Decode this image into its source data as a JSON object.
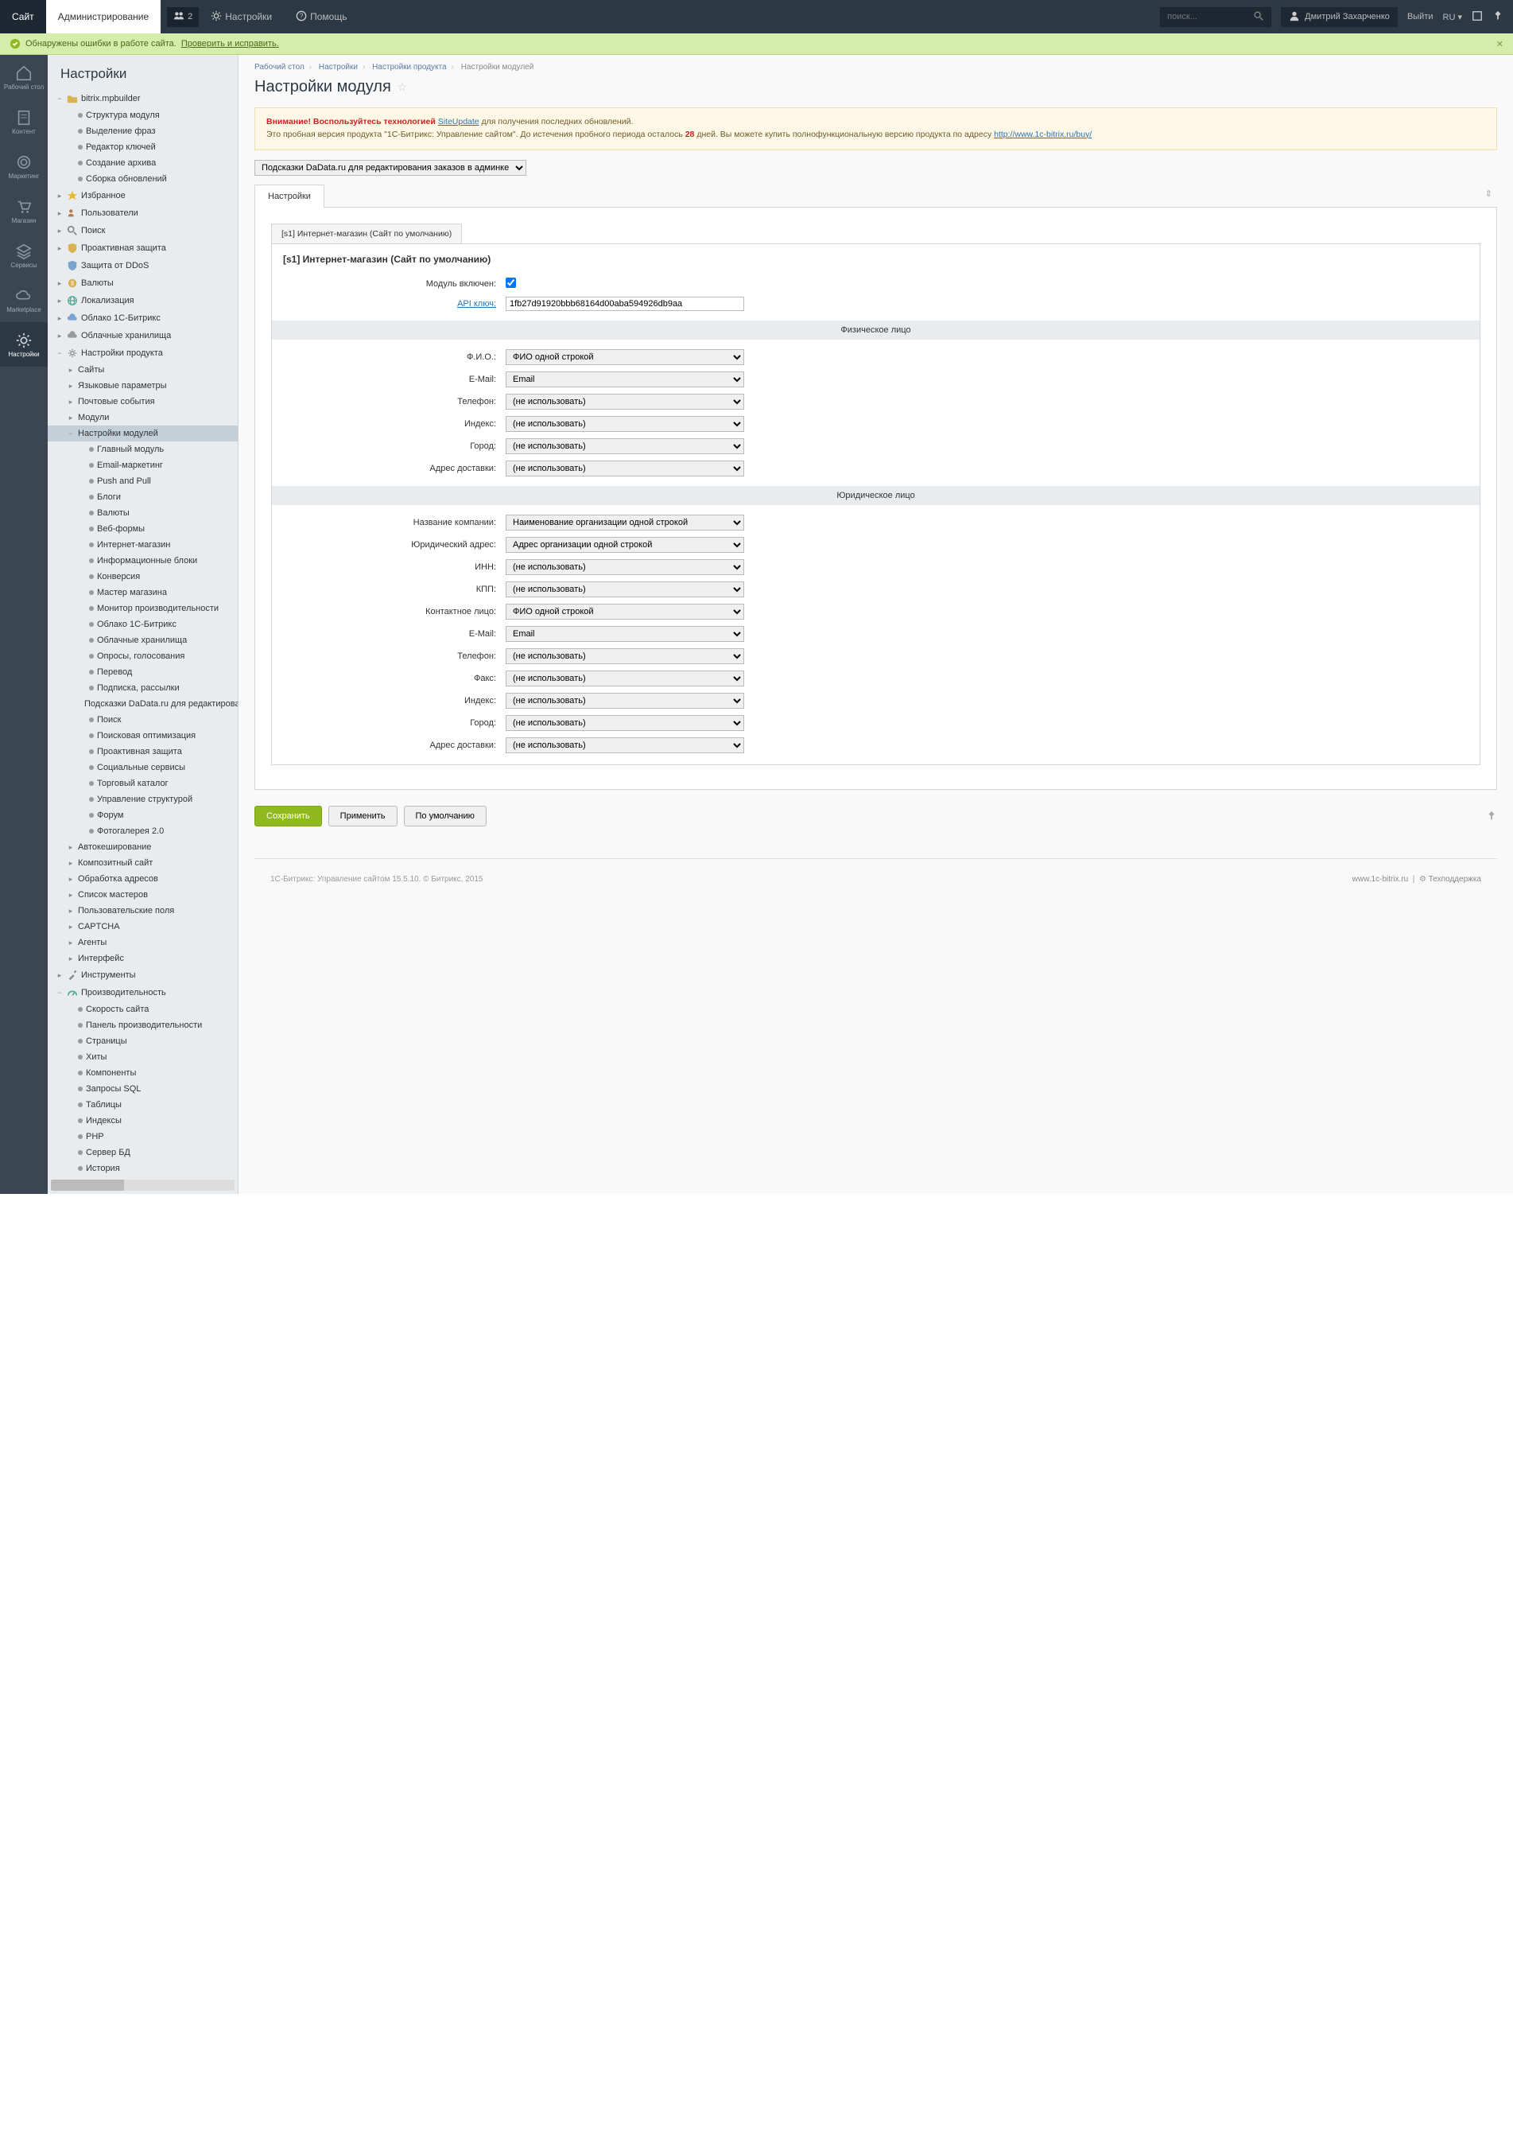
{
  "topbar": {
    "tab_site": "Сайт",
    "tab_admin": "Администрирование",
    "badge_count": "2",
    "link_settings": "Настройки",
    "link_help": "Помощь",
    "search_placeholder": "поиск...",
    "user_name": "Дмитрий Захарченко",
    "logout": "Выйти",
    "lang": "RU"
  },
  "alert": {
    "text": "Обнаружены ошибки в работе сайта.",
    "link": "Проверить и исправить."
  },
  "iconbar": {
    "items": [
      "Рабочий стол",
      "Контент",
      "Маркетинг",
      "Магазин",
      "Сервисы",
      "Marketplace",
      "Настройки"
    ]
  },
  "sidebar": {
    "title": "Настройки",
    "tree": [
      {
        "lvl": 0,
        "arrow": "−",
        "icon": "folder",
        "label": "bitrix.mpbuilder"
      },
      {
        "lvl": 1,
        "dot": true,
        "label": "Структура модуля"
      },
      {
        "lvl": 1,
        "dot": true,
        "label": "Выделение фраз"
      },
      {
        "lvl": 1,
        "dot": true,
        "label": "Редактор ключей"
      },
      {
        "lvl": 1,
        "dot": true,
        "label": "Создание архива"
      },
      {
        "lvl": 1,
        "dot": true,
        "label": "Сборка обновлений"
      },
      {
        "lvl": 0,
        "arrow": "▸",
        "icon": "star",
        "label": "Избранное"
      },
      {
        "lvl": 0,
        "arrow": "▸",
        "icon": "users",
        "label": "Пользователи"
      },
      {
        "lvl": 0,
        "arrow": "▸",
        "icon": "search",
        "label": "Поиск"
      },
      {
        "lvl": 0,
        "arrow": "▸",
        "icon": "shield",
        "label": "Проактивная защита"
      },
      {
        "lvl": 0,
        "arrow": " ",
        "icon": "shield2",
        "label": "Защита от DDoS"
      },
      {
        "lvl": 0,
        "arrow": "▸",
        "icon": "currency",
        "label": "Валюты"
      },
      {
        "lvl": 0,
        "arrow": "▸",
        "icon": "globe",
        "label": "Локализация"
      },
      {
        "lvl": 0,
        "arrow": "▸",
        "icon": "cloud",
        "label": "Облако 1С-Битрикс"
      },
      {
        "lvl": 0,
        "arrow": "▸",
        "icon": "clouds",
        "label": "Облачные хранилища"
      },
      {
        "lvl": 0,
        "arrow": "−",
        "icon": "gear",
        "label": "Настройки продукта"
      },
      {
        "lvl": 1,
        "arrow": "▸",
        "label": "Сайты"
      },
      {
        "lvl": 1,
        "arrow": "▸",
        "label": "Языковые параметры"
      },
      {
        "lvl": 1,
        "arrow": "▸",
        "label": "Почтовые события"
      },
      {
        "lvl": 1,
        "arrow": "▸",
        "label": "Модули"
      },
      {
        "lvl": 1,
        "arrow": "−",
        "label": "Настройки модулей",
        "active": true
      },
      {
        "lvl": 2,
        "dot": true,
        "label": "Главный модуль"
      },
      {
        "lvl": 2,
        "dot": true,
        "label": "Email-маркетинг"
      },
      {
        "lvl": 2,
        "dot": true,
        "label": "Push and Pull"
      },
      {
        "lvl": 2,
        "dot": true,
        "label": "Блоги"
      },
      {
        "lvl": 2,
        "dot": true,
        "label": "Валюты"
      },
      {
        "lvl": 2,
        "dot": true,
        "label": "Веб-формы"
      },
      {
        "lvl": 2,
        "dot": true,
        "label": "Интернет-магазин"
      },
      {
        "lvl": 2,
        "dot": true,
        "label": "Информационные блоки"
      },
      {
        "lvl": 2,
        "dot": true,
        "label": "Конверсия"
      },
      {
        "lvl": 2,
        "dot": true,
        "label": "Мастер магазина"
      },
      {
        "lvl": 2,
        "dot": true,
        "label": "Монитор производительности"
      },
      {
        "lvl": 2,
        "dot": true,
        "label": "Облако 1С-Битрикс"
      },
      {
        "lvl": 2,
        "dot": true,
        "label": "Облачные хранилища"
      },
      {
        "lvl": 2,
        "dot": true,
        "label": "Опросы, голосования"
      },
      {
        "lvl": 2,
        "dot": true,
        "label": "Перевод"
      },
      {
        "lvl": 2,
        "dot": true,
        "label": "Подписка, рассылки"
      },
      {
        "lvl": 2,
        "dot": true,
        "label": "Подсказки DaData.ru для редактирования заказов в админке"
      },
      {
        "lvl": 2,
        "dot": true,
        "label": "Поиск"
      },
      {
        "lvl": 2,
        "dot": true,
        "label": "Поисковая оптимизация"
      },
      {
        "lvl": 2,
        "dot": true,
        "label": "Проактивная защита"
      },
      {
        "lvl": 2,
        "dot": true,
        "label": "Социальные сервисы"
      },
      {
        "lvl": 2,
        "dot": true,
        "label": "Торговый каталог"
      },
      {
        "lvl": 2,
        "dot": true,
        "label": "Управление структурой"
      },
      {
        "lvl": 2,
        "dot": true,
        "label": "Форум"
      },
      {
        "lvl": 2,
        "dot": true,
        "label": "Фотогалерея 2.0"
      },
      {
        "lvl": 1,
        "arrow": "▸",
        "label": "Автокеширование"
      },
      {
        "lvl": 1,
        "arrow": "▸",
        "label": "Композитный сайт"
      },
      {
        "lvl": 1,
        "arrow": "▸",
        "label": "Обработка адресов"
      },
      {
        "lvl": 1,
        "arrow": "▸",
        "label": "Список мастеров"
      },
      {
        "lvl": 1,
        "arrow": "▸",
        "label": "Пользовательские поля"
      },
      {
        "lvl": 1,
        "arrow": "▸",
        "label": "CAPTCHA"
      },
      {
        "lvl": 1,
        "arrow": "▸",
        "label": "Агенты"
      },
      {
        "lvl": 1,
        "arrow": "▸",
        "label": "Интерфейс"
      },
      {
        "lvl": 0,
        "arrow": "▸",
        "icon": "tools",
        "label": "Инструменты"
      },
      {
        "lvl": 0,
        "arrow": "−",
        "icon": "perf",
        "label": "Производительность"
      },
      {
        "lvl": 1,
        "dot": true,
        "label": "Скорость сайта"
      },
      {
        "lvl": 1,
        "dot": true,
        "label": "Панель производительности"
      },
      {
        "lvl": 1,
        "dot": true,
        "label": "Страницы"
      },
      {
        "lvl": 1,
        "dot": true,
        "label": "Хиты"
      },
      {
        "lvl": 1,
        "dot": true,
        "label": "Компоненты"
      },
      {
        "lvl": 1,
        "dot": true,
        "label": "Запросы SQL"
      },
      {
        "lvl": 1,
        "dot": true,
        "label": "Таблицы"
      },
      {
        "lvl": 1,
        "dot": true,
        "label": "Индексы"
      },
      {
        "lvl": 1,
        "dot": true,
        "label": "PHP"
      },
      {
        "lvl": 1,
        "dot": true,
        "label": "Сервер БД"
      },
      {
        "lvl": 1,
        "dot": true,
        "label": "История"
      }
    ]
  },
  "breadcrumb": [
    "Рабочий стол",
    "Настройки",
    "Настройки продукта",
    "Настройки модулей"
  ],
  "page_title": "Настройки модуля",
  "warn": {
    "l1a": "Внимание! Воспользуйтесь технологией ",
    "l1link": "SiteUpdate",
    "l1b": " для получения последних обновлений.",
    "l2a": "Это пробная версия продукта \"1С-Битрикс: Управление сайтом\". До истечения пробного периода осталось ",
    "l2days": "28",
    "l2b": " дней. Вы можете купить полнофункциональную версию продукта по адресу ",
    "l2link": "http://www.1c-bitrix.ru/buy/"
  },
  "module_select": "Подсказки DaData.ru для редактирования заказов в админке",
  "tab_label": "Настройки",
  "inner_tab": "[s1] Интернет-магазин (Сайт по умолчанию)",
  "inner_title": "[s1] Интернет-магазин (Сайт по умолчанию)",
  "form": {
    "module_enabled": "Модуль включен:",
    "api_key": "API ключ:",
    "api_value": "1fb27d91920bbb68164d00aba594926db9aa",
    "section_phys": "Физическое лицо",
    "section_jur": "Юридическое лицо",
    "opt_not_use": "(не использовать)",
    "opt_fio": "ФИО одной строкой",
    "opt_email": "Email",
    "opt_org": "Наименование организации одной строкой",
    "opt_addr": "Адрес организации одной строкой",
    "phys": {
      "fio": "Ф.И.О.:",
      "email": "E-Mail:",
      "phone": "Телефон:",
      "index": "Индекс:",
      "city": "Город:",
      "delivery": "Адрес доставки:"
    },
    "jur": {
      "company": "Название компании:",
      "juraddr": "Юридический адрес:",
      "inn": "ИНН:",
      "kpp": "КПП:",
      "contact": "Контактное лицо:",
      "email": "E-Mail:",
      "phone": "Телефон:",
      "fax": "Факс:",
      "index": "Индекс:",
      "city": "Город:",
      "delivery": "Адрес доставки:"
    }
  },
  "actions": {
    "save": "Сохранить",
    "apply": "Применить",
    "default": "По умолчанию"
  },
  "footer": {
    "left": "1С-Битрикс: Управление сайтом 15.5.10. © Битрикс, 2015",
    "link1": "www.1c-bitrix.ru",
    "link2": "Техподдержка"
  }
}
